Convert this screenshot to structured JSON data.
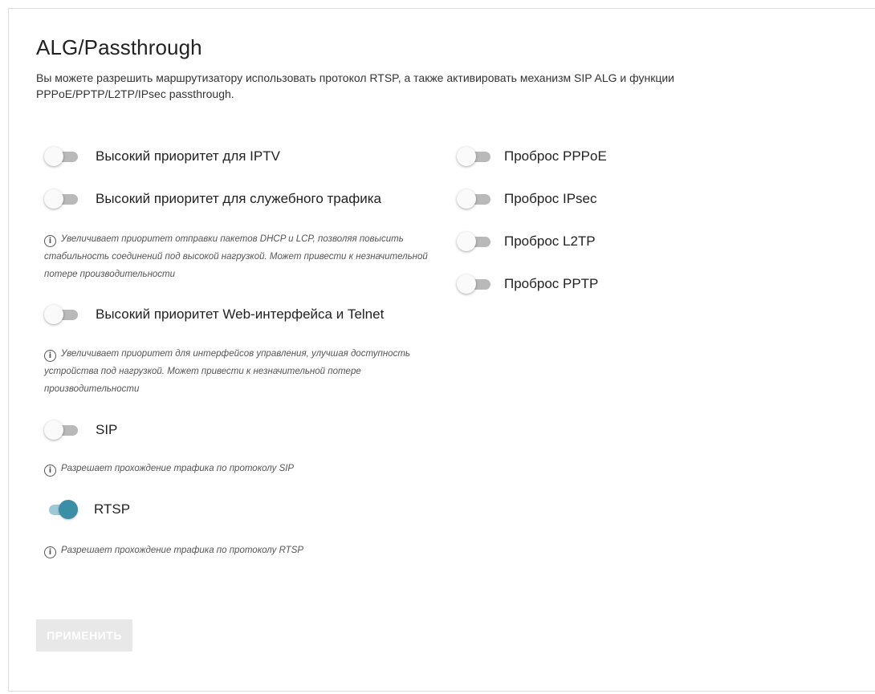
{
  "page": {
    "title": "ALG/Passthrough",
    "description": "Вы можете разрешить маршрутизатору использовать протокол RTSP, а также активировать механизм SIP ALG и функции PPPoE/PPTP/L2TP/IPsec passthrough."
  },
  "left_options": {
    "iptv": {
      "label": "Высокий приоритет для IPTV",
      "enabled": false
    },
    "service_traffic": {
      "label": "Высокий приоритет для служебного трафика",
      "enabled": false,
      "hint": "Увеличивает приоритет отправки пакетов DHCP и LCP, позволяя повысить стабильность соединений под высокой нагрузкой. Может привести к незначительной потере производительности"
    },
    "web_telnet": {
      "label": "Высокий приоритет Web-интерфейса и Telnet",
      "enabled": false,
      "hint": "Увеличивает приоритет для интерфейсов управления, улучшая доступность устройства под нагрузкой. Может привести к незначительной потере производительности"
    },
    "sip": {
      "label": "SIP",
      "enabled": false,
      "hint": "Разрешает прохождение трафика по протоколу SIP"
    },
    "rtsp": {
      "label": "RTSP",
      "enabled": true,
      "hint": "Разрешает прохождение трафика по протоколу RTSP"
    }
  },
  "right_options": {
    "pppoe": {
      "label": "Проброс PPPoE",
      "enabled": false
    },
    "ipsec": {
      "label": "Проброс IPsec",
      "enabled": false
    },
    "l2tp": {
      "label": "Проброс L2TP",
      "enabled": false
    },
    "pptp": {
      "label": "Проброс PPTP",
      "enabled": false
    }
  },
  "actions": {
    "apply_label": "ПРИМЕНИТЬ",
    "apply_enabled": false
  },
  "colors": {
    "toggle_on_thumb": "#3a8fa6",
    "toggle_on_track": "#9cc9d6",
    "toggle_off_track": "#b9b9b9",
    "button_disabled": "#e8e8e8"
  },
  "icons": {
    "info": "info-circle-icon"
  }
}
